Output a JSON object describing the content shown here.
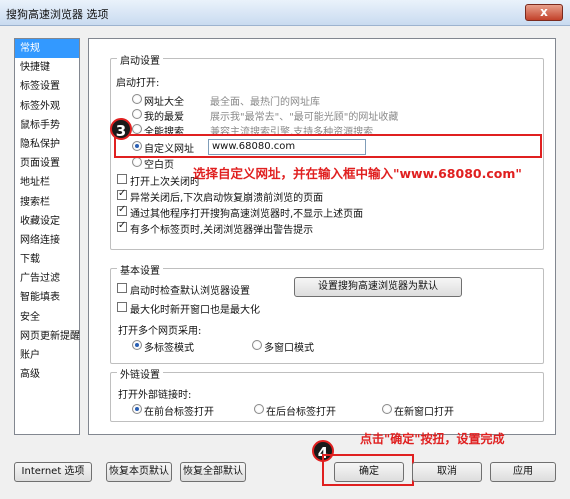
{
  "window": {
    "title": "搜狗高速浏览器 选项",
    "close_label": "x"
  },
  "sidebar": {
    "items": [
      {
        "label": "常规",
        "active": true
      },
      {
        "label": "快捷键"
      },
      {
        "label": "标签设置"
      },
      {
        "label": "标签外观"
      },
      {
        "label": "鼠标手势"
      },
      {
        "label": "隐私保护"
      },
      {
        "label": "页面设置"
      },
      {
        "label": "地址栏"
      },
      {
        "label": "搜索栏"
      },
      {
        "label": "收藏设定"
      },
      {
        "label": "网络连接"
      },
      {
        "label": "下载"
      },
      {
        "label": "广告过滤"
      },
      {
        "label": "智能填表"
      },
      {
        "label": "安全"
      },
      {
        "label": "网页更新提醒"
      },
      {
        "label": "账户"
      },
      {
        "label": "高级"
      }
    ]
  },
  "startup": {
    "legend": "启动设置",
    "open_label": "启动打开:",
    "options": [
      {
        "label": "网址大全",
        "desc": "最全面、最热门的网址库",
        "selected": false
      },
      {
        "label": "我的最爱",
        "desc": "展示我\"最常去\"、\"最可能光顾\"的网址收藏",
        "selected": false
      },
      {
        "label": "全能搜索",
        "desc": "兼容主流搜索引擎,支持多种资源搜索",
        "selected": false
      },
      {
        "label": "自定义网址",
        "desc": "",
        "selected": true
      },
      {
        "label": "空白页",
        "desc": "",
        "selected": false
      }
    ],
    "url_value": "www.68080.com",
    "checks": [
      {
        "label": "打开上次关闭时",
        "checked": false
      },
      {
        "label": "异常关闭后,下次启动恢复崩溃前浏览的页面",
        "checked": true
      },
      {
        "label": "通过其他程序打开搜狗高速浏览器时,不显示上述页面",
        "checked": true
      },
      {
        "label": "有多个标签页时,关闭浏览器弹出警告提示",
        "checked": true
      }
    ]
  },
  "basic": {
    "legend": "基本设置",
    "check_default": "启动时检查默认浏览器设置",
    "check_maximize": "最大化时新开窗口也是最大化",
    "set_default_button": "设置搜狗高速浏览器为默认",
    "multi_label": "打开多个网页采用:",
    "radio_multi_tab": "多标签模式",
    "radio_multi_window": "多窗口模式"
  },
  "external": {
    "legend": "外链设置",
    "open_label": "打开外部链接时:",
    "radio_front_tab": "在前台标签打开",
    "radio_back_tab": "在后台标签打开",
    "radio_new_window": "在新窗口打开"
  },
  "annotations": {
    "step3_number": "3",
    "step3_text": "选择自定义网址，并在输入框中输入\"www.68080.com\"",
    "step4_number": "4",
    "step4_text": "点击\"确定\"按扭，设置完成"
  },
  "footer": {
    "internet_options": "Internet 选项",
    "restore_page": "恢复本页默认",
    "restore_all": "恢复全部默认",
    "ok": "确定",
    "cancel": "取消",
    "apply": "应用"
  }
}
